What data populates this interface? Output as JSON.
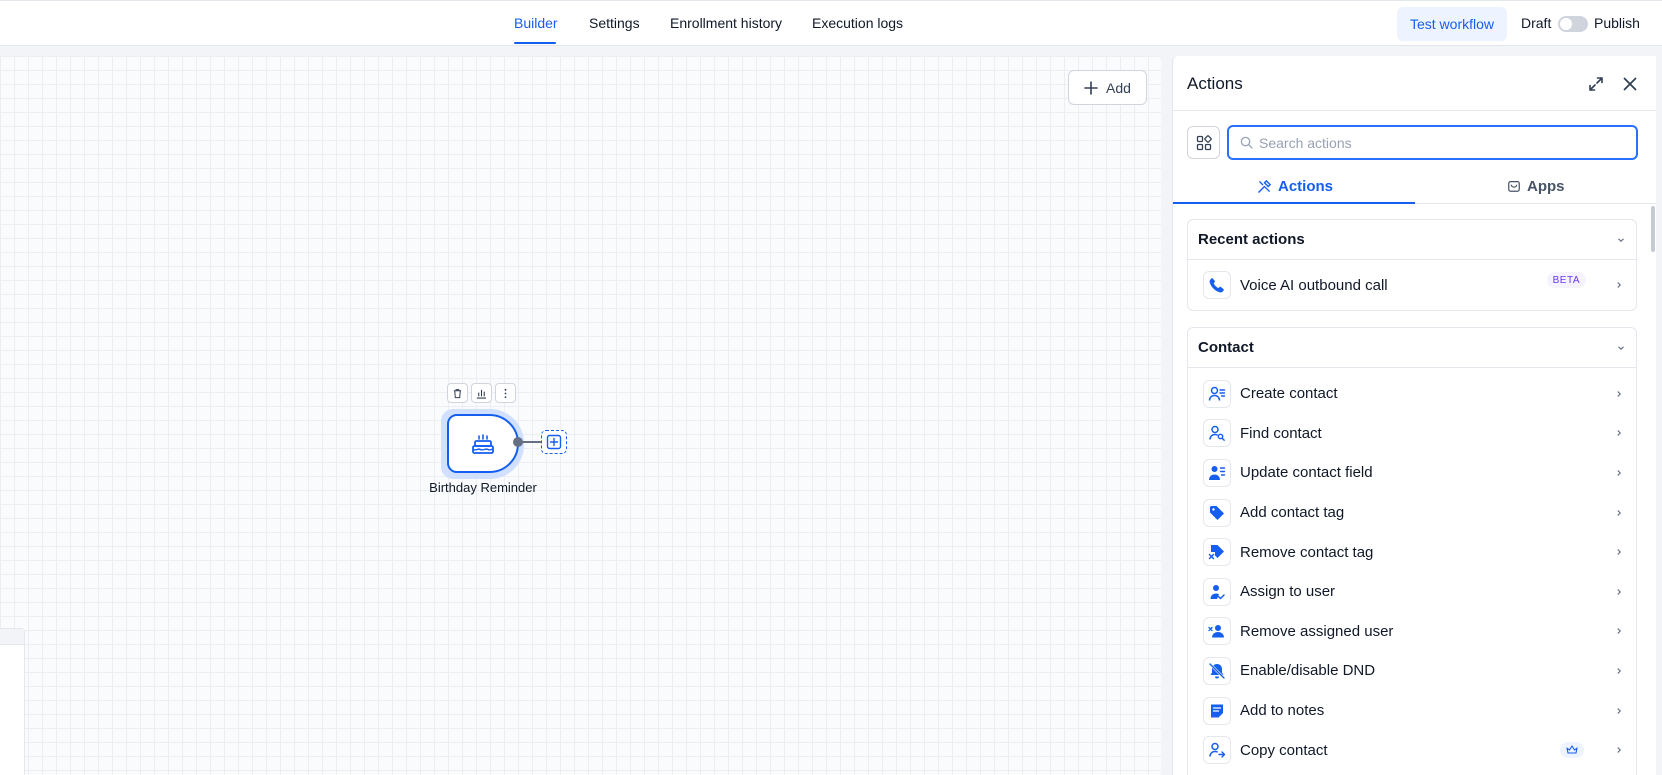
{
  "nav": {
    "tabs": [
      {
        "label": "Builder",
        "active": true
      },
      {
        "label": "Settings",
        "active": false
      },
      {
        "label": "Enrollment history",
        "active": false
      },
      {
        "label": "Execution logs",
        "active": false
      }
    ],
    "test_workflow_label": "Test workflow",
    "draft_label": "Draft",
    "publish_label": "Publish",
    "publish_toggle_on": false
  },
  "canvas": {
    "add_label": "Add",
    "node": {
      "label": "Birthday Reminder",
      "icon": "birthday-cake-icon"
    }
  },
  "panel": {
    "title": "Actions",
    "search_placeholder": "Search actions",
    "search_value": "",
    "tabs": [
      {
        "label": "Actions",
        "icon": "tools-icon",
        "active": true
      },
      {
        "label": "Apps",
        "icon": "store-icon",
        "active": false
      }
    ],
    "sections": [
      {
        "title": "Recent actions",
        "items": [
          {
            "label": "Voice AI outbound call",
            "icon": "phone-icon",
            "badge": "BETA"
          }
        ]
      },
      {
        "title": "Contact",
        "items": [
          {
            "label": "Create contact",
            "icon": "user-list-icon"
          },
          {
            "label": "Find contact",
            "icon": "user-search-icon"
          },
          {
            "label": "Update contact field",
            "icon": "user-edit-icon"
          },
          {
            "label": "Add contact tag",
            "icon": "tag-icon"
          },
          {
            "label": "Remove contact tag",
            "icon": "tag-remove-icon"
          },
          {
            "label": "Assign to user",
            "icon": "user-assign-icon"
          },
          {
            "label": "Remove assigned user",
            "icon": "user-remove-icon"
          },
          {
            "label": "Enable/disable DND",
            "icon": "bell-off-icon"
          },
          {
            "label": "Add to notes",
            "icon": "note-icon"
          },
          {
            "label": "Copy contact",
            "icon": "user-copy-icon",
            "premium": true
          }
        ]
      }
    ]
  },
  "colors": {
    "accent": "#155eef",
    "accent_light": "#eef4ff",
    "beta_text": "#6938ef",
    "border": "#e4e7ec"
  }
}
